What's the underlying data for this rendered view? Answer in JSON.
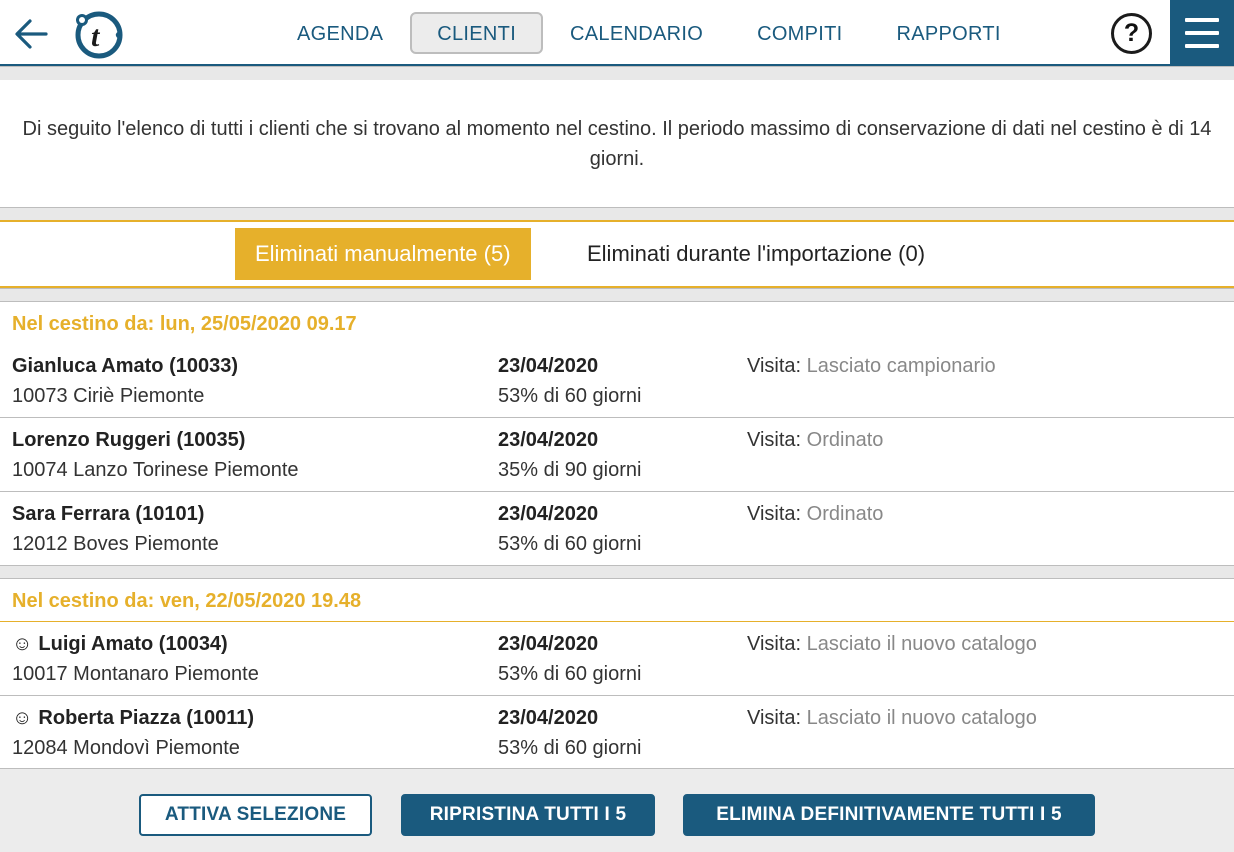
{
  "header": {
    "nav": [
      {
        "label": "AGENDA"
      },
      {
        "label": "CLIENTI",
        "active": true
      },
      {
        "label": "CALENDARIO"
      },
      {
        "label": "COMPITI"
      },
      {
        "label": "RAPPORTI"
      }
    ],
    "help_label": "?"
  },
  "intro": "Di seguito l'elenco di tutti i clienti che si trovano al momento nel cestino. Il periodo massimo di conservazione di dati nel cestino è di 14 giorni.",
  "tabs": {
    "manual": "Eliminati manualmente (5)",
    "import": "Eliminati durante l'importazione (0)"
  },
  "groups": [
    {
      "header": "Nel cestino da: lun, 25/05/2020 09.17",
      "rows": [
        {
          "name": "Gianluca Amato (10033)",
          "address": "10073 Ciriè Piemonte",
          "date": "23/04/2020",
          "pct": "53% di 60 giorni",
          "visit_label": "Visita:",
          "visit_value": "Lasciato campionario"
        },
        {
          "name": "Lorenzo Ruggeri (10035)",
          "address": "10074 Lanzo Torinese Piemonte",
          "date": "23/04/2020",
          "pct": "35% di 90 giorni",
          "visit_label": "Visita:",
          "visit_value": "Ordinato"
        },
        {
          "name": "Sara Ferrara (10101)",
          "address": "12012 Boves Piemonte",
          "date": "23/04/2020",
          "pct": "53% di 60 giorni",
          "visit_label": "Visita:",
          "visit_value": "Ordinato"
        }
      ]
    },
    {
      "header": "Nel cestino da: ven, 22/05/2020 19.48",
      "rows": [
        {
          "icon": "☺",
          "name": "Luigi Amato (10034)",
          "address": "10017 Montanaro Piemonte",
          "date": "23/04/2020",
          "pct": "53% di 60 giorni",
          "visit_label": "Visita:",
          "visit_value": "Lasciato il nuovo catalogo"
        },
        {
          "icon": "☺",
          "name": "Roberta Piazza (10011)",
          "address": "12084 Mondovì Piemonte",
          "date": "23/04/2020",
          "pct": "53% di 60 giorni",
          "visit_label": "Visita:",
          "visit_value": "Lasciato il nuovo catalogo"
        }
      ]
    }
  ],
  "footer": {
    "select_label": "ATTIVA SELEZIONE",
    "restore_label": "RIPRISTINA TUTTI I 5",
    "delete_label": "ELIMINA DEFINITIVAMENTE TUTTI I 5"
  },
  "colors": {
    "primary": "#1a5a7e",
    "accent": "#e6b02b"
  }
}
